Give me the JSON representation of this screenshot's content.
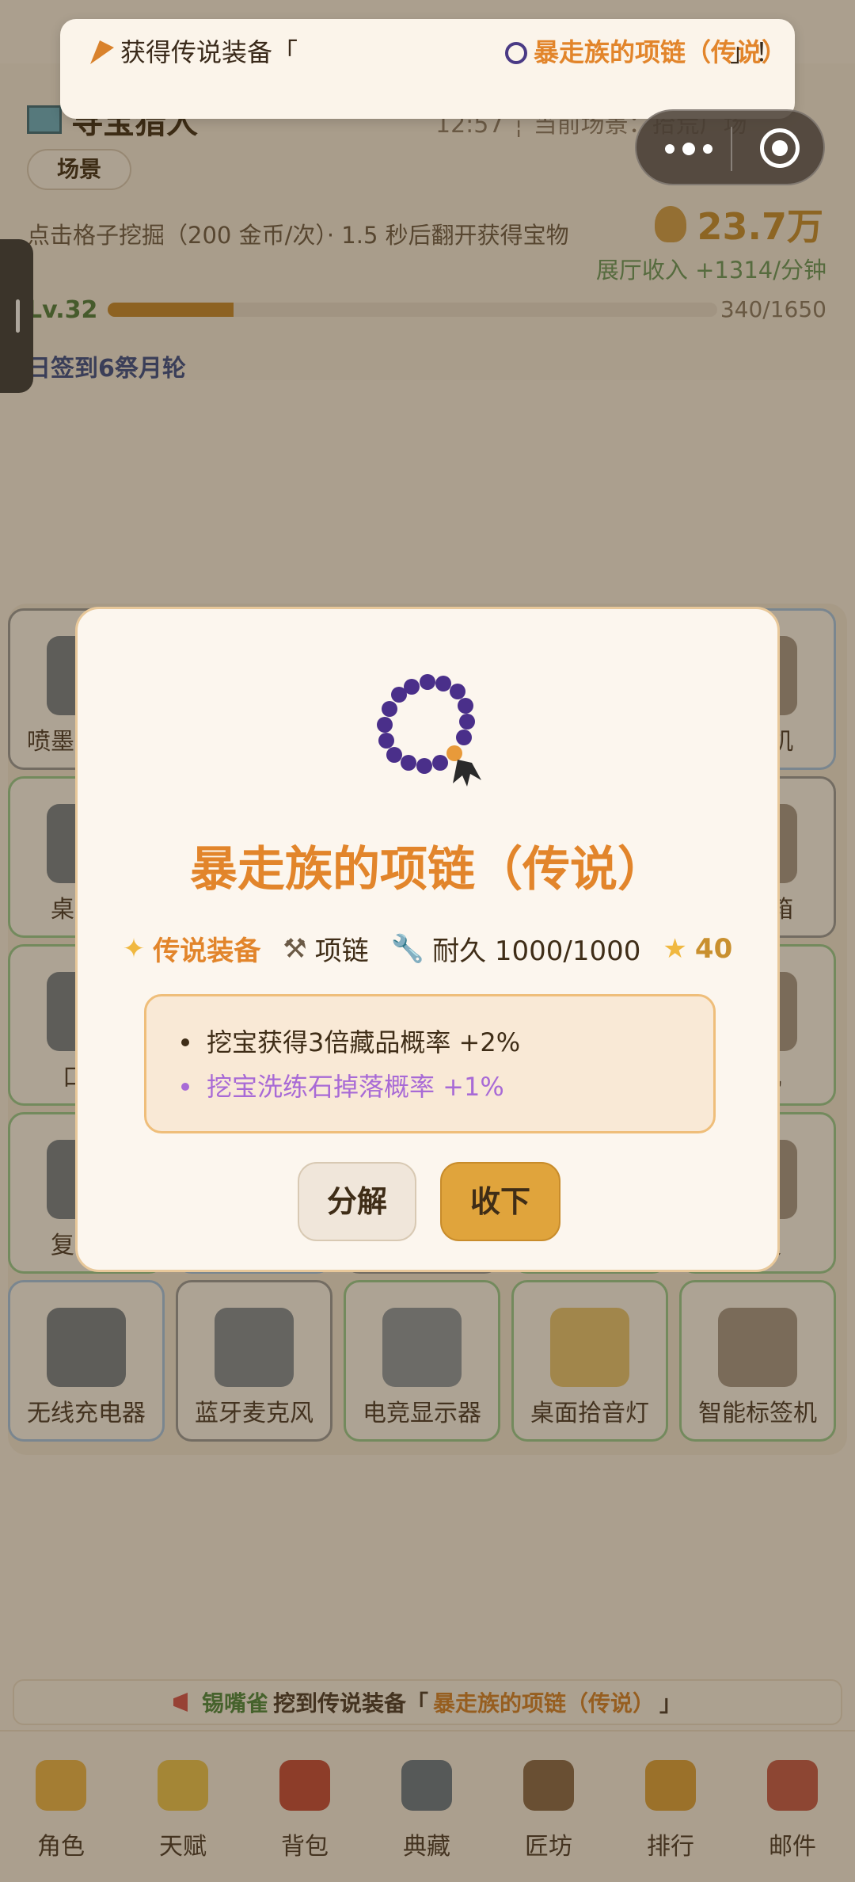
{
  "header": {
    "app_title": "寻宝猎人",
    "clock_line": "12:57 ┆ 当前场景：拾荒广场",
    "scene_tag": "场景",
    "dig_hint": "点击格子挖掘（200 金币/次）· 1.5 秒后翻开获得宝物",
    "gold": "23.7万",
    "income": "展厅收入 +1314/分钟",
    "level": "Lv.32",
    "exp_text": "340/1650",
    "exp_progress": 0.206,
    "checkin": "日签到6祭月轮"
  },
  "grid": {
    "cells": [
      {
        "label": "喷墨打印机"
      },
      {
        "label": ""
      },
      {
        "label": ""
      },
      {
        "label": ""
      },
      {
        "label": "智能机"
      },
      {
        "label": "桌面蓝"
      },
      {
        "label": ""
      },
      {
        "label": ""
      },
      {
        "label": ""
      },
      {
        "label": "开音箱"
      },
      {
        "label": "口袋"
      },
      {
        "label": ""
      },
      {
        "label": ""
      },
      {
        "label": ""
      },
      {
        "label": "烫机"
      },
      {
        "label": "复古服"
      },
      {
        "label": ""
      },
      {
        "label": ""
      },
      {
        "label": ""
      },
      {
        "label": "距仪"
      },
      {
        "label": "无线充电器"
      },
      {
        "label": "蓝牙麦克风"
      },
      {
        "label": "电竞显示器"
      },
      {
        "label": "桌面拾音灯"
      },
      {
        "label": "智能标签机"
      }
    ]
  },
  "toast": {
    "left_text": "获得传说装备「",
    "item_text": "暴走族的项链（传说）",
    "close_quote": "」！"
  },
  "modal": {
    "item_name": "暴走族的项链（传说）",
    "rarity": "传说装备",
    "slot": "项链",
    "durability": "耐久 1000/1000",
    "score": "40",
    "affixes": [
      "挖宝获得3倍藏品概率 +2%",
      "挖宝洗练石掉落概率 +1%"
    ],
    "decompose_label": "分解",
    "accept_label": "收下"
  },
  "broadcast": {
    "player": "锡嘴雀",
    "action": "挖到传说装备「",
    "item": "暴走族的项链（传说）",
    "close": "」"
  },
  "tabbar": {
    "tabs": [
      {
        "label": "角色"
      },
      {
        "label": "天赋"
      },
      {
        "label": "背包"
      },
      {
        "label": "典藏"
      },
      {
        "label": "匠坊"
      },
      {
        "label": "排行"
      },
      {
        "label": "邮件"
      }
    ]
  },
  "colors": {
    "accent": "#e2852b",
    "gold": "#c9902f",
    "button_primary": "#e0a43c",
    "purple_affix": "#a86ad6"
  }
}
